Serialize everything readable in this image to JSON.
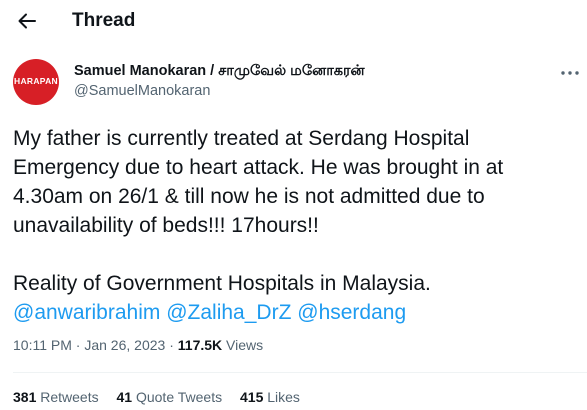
{
  "header": {
    "title": "Thread",
    "back_icon": "arrow-left-icon"
  },
  "author": {
    "name": "Samuel Manokaran / சாமுவேல் மனோகரன்",
    "handle": "@SamuelManokaran",
    "avatar_logo_text": "HARAPAN",
    "avatar_color": "#d71f26"
  },
  "tweet": {
    "lines": [
      "My father is currently treated at Serdang Hospital",
      "Emergency due to heart attack. He was brought in at",
      "4.30am on 26/1 & till now he is not admitted due to",
      "unavailability of beds!!! 17hours!!",
      "Reality of Government Hospitals in Malaysia."
    ],
    "mentions": [
      "@anwaribrahim",
      "@Zaliha_DrZ",
      "@hserdang"
    ]
  },
  "meta": {
    "time": "10:11 PM",
    "separator": "·",
    "date": "Jan 26, 2023",
    "views_count": "117.5K",
    "views_label": "Views"
  },
  "stats": {
    "retweets_count": "381",
    "retweets_label": "Retweets",
    "quotes_count": "41",
    "quotes_label": "Quote Tweets",
    "likes_count": "415",
    "likes_label": "Likes"
  },
  "colors": {
    "accent": "#1d9bf0",
    "text": "#0f1419",
    "muted": "#536471"
  }
}
